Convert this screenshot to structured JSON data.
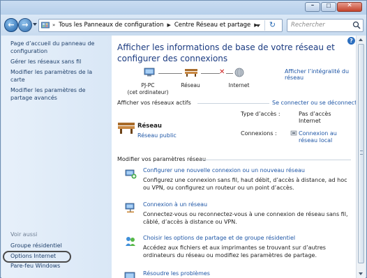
{
  "window": {
    "caption": {
      "minimize_icon": "minimize-icon",
      "maximize_icon": "maximize-icon",
      "close_icon": "close-icon"
    }
  },
  "address_bar": {
    "crumbs": [
      "Tous les Panneaux de configuration",
      "Centre Réseau et partage"
    ],
    "search_placeholder": "Rechercher"
  },
  "left_pane": {
    "links": [
      "Page d’accueil du panneau de configuration",
      "Gérer les réseaux sans fil",
      "Modifier les paramètres de la carte",
      "Modifier les paramètres de partage avancés"
    ],
    "see_also_label": "Voir aussi",
    "see_also": [
      "Groupe résidentiel",
      "Options Internet",
      "Pare-feu Windows"
    ]
  },
  "main": {
    "heading": "Afficher les informations de base de votre réseau et configurer des connexions",
    "full_map_link": "Afficher l’intégralité du réseau",
    "map": {
      "pc_name": "PJ-PC",
      "pc_sub": "(cet ordinateur)",
      "network": "Réseau",
      "internet": "Internet"
    },
    "active_label": "Afficher vos réseaux actifs",
    "connect_link": "Se connecter ou se déconnecter",
    "active_network": {
      "name": "Réseau",
      "type": "Réseau public",
      "access_label": "Type d’accès :",
      "access_value": "Pas d’accès Internet",
      "connections_label": "Connexions :",
      "connections_value": "Connexion au réseau local"
    },
    "settings_label": "Modifier vos paramètres réseau",
    "tasks": [
      {
        "icon": "new-connection-icon",
        "title": "Configurer une nouvelle connexion ou un nouveau réseau",
        "desc": "Configurez une connexion sans fil, haut débit, d’accès à distance, ad hoc ou VPN, ou configurez un routeur ou un point d’accès."
      },
      {
        "icon": "connect-network-icon",
        "title": "Connexion à un réseau",
        "desc": "Connectez-vous ou reconnectez-vous à une connexion de réseau sans fil, câblé, d’accès à distance ou VPN."
      },
      {
        "icon": "homegroup-icon",
        "title": "Choisir les options de partage et de groupe résidentiel",
        "desc": "Accédez aux fichiers et aux imprimantes se trouvant sur d’autres ordinateurs du réseau ou modifiez les paramètres de partage."
      },
      {
        "icon": "troubleshoot-icon",
        "title": "Résoudre les problèmes",
        "desc": ""
      }
    ]
  }
}
